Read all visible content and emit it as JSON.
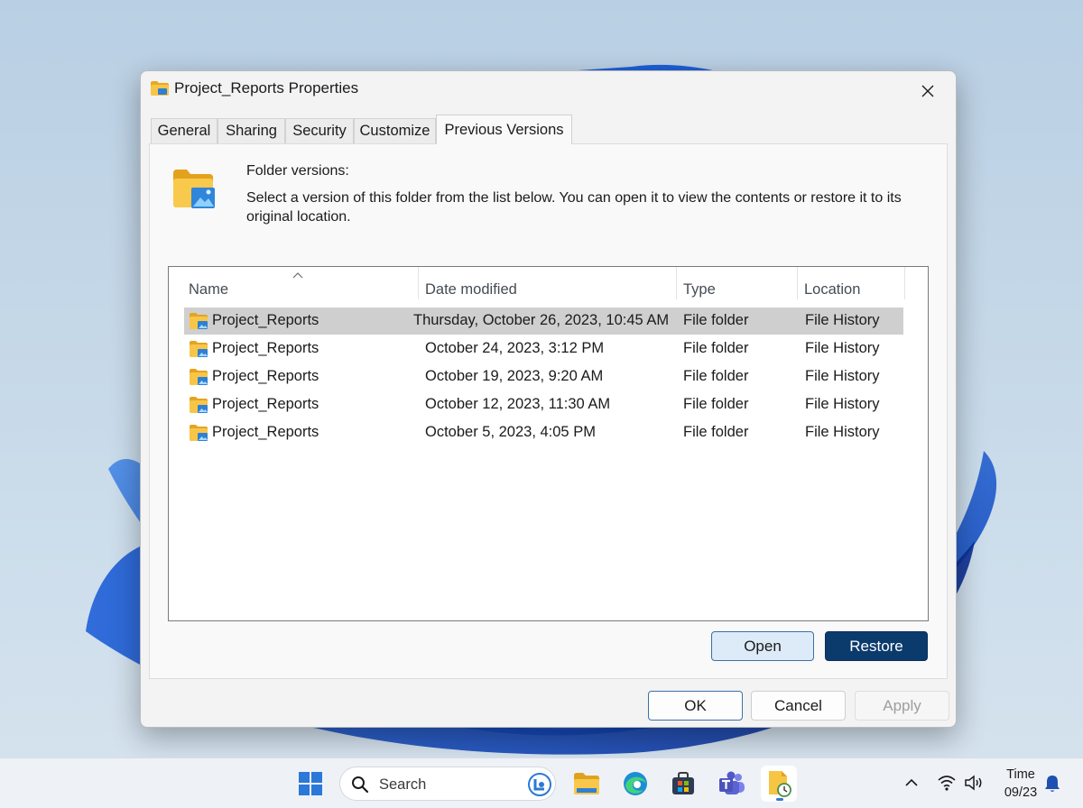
{
  "dialog": {
    "title": "Project_Reports Properties",
    "tabs": [
      {
        "label": "General"
      },
      {
        "label": "Sharing"
      },
      {
        "label": "Security"
      },
      {
        "label": "Customize"
      },
      {
        "label": "Previous Versions",
        "active": true
      }
    ],
    "heading": "Folder versions:",
    "description": "Select a version of this folder from the list below. You can open it to view the contents or restore it to its original location.",
    "columns": {
      "name": "Name",
      "date": "Date modified",
      "type": "Type",
      "location": "Location"
    },
    "versions": [
      {
        "name": "Project_Reports",
        "date": "Thursday, October 26, 2023, 10:45 AM",
        "type": "File folder",
        "location": "File History",
        "selected": true
      },
      {
        "name": "Project_Reports",
        "date": "October 24, 2023, 3:12 PM",
        "type": "File folder",
        "location": "File History"
      },
      {
        "name": "Project_Reports",
        "date": "October 19, 2023, 9:20 AM",
        "type": "File folder",
        "location": "File History"
      },
      {
        "name": "Project_Reports",
        "date": "October 12, 2023, 11:30 AM",
        "type": "File folder",
        "location": "File History"
      },
      {
        "name": "Project_Reports",
        "date": "October 5, 2023, 4:05 PM",
        "type": "File folder",
        "location": "File History"
      }
    ],
    "buttons": {
      "open": "Open",
      "restore": "Restore",
      "ok": "OK",
      "cancel": "Cancel",
      "apply": "Apply"
    }
  },
  "taskbar": {
    "search_label": "Search",
    "clock": {
      "time": "Time",
      "date": "09/23"
    }
  },
  "colors": {
    "restore_button": "#0b3a6d",
    "open_button": "#dcebf7",
    "selected_row": "#cfcfcf",
    "folder_yellow": "#f6c543",
    "accent_blue": "#1f6fd1"
  },
  "icons": [
    "folder-icon",
    "close-icon",
    "sort-up-icon",
    "windows-start-icon",
    "search-icon",
    "copilot-icon",
    "file-explorer-icon",
    "edge-icon",
    "store-icon",
    "teams-icon",
    "file-history-icon",
    "chevron-up-icon",
    "wifi-icon",
    "volume-icon",
    "bell-icon"
  ]
}
